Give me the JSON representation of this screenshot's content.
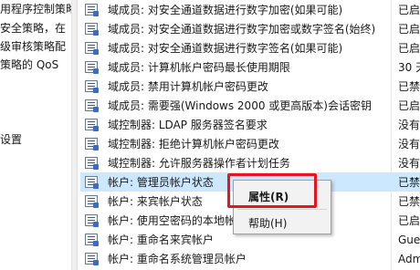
{
  "tree": {
    "items": [
      {
        "label": "用程序控制策略"
      },
      {
        "label": "安全策略，在"
      },
      {
        "label": "级审核策略配"
      },
      {
        "label": "策略的 QoS"
      },
      {
        "label": "设置"
      }
    ]
  },
  "policies": [
    {
      "name": "域成员: 对安全通道数据进行数字加密(如果可能)",
      "setting": "已启"
    },
    {
      "name": "域成员: 对安全通道数据进行数字加密或数字签名(始终)",
      "setting": "已启"
    },
    {
      "name": "域成员: 对安全通道数据进行数字签名(如果可能)",
      "setting": "已启"
    },
    {
      "name": "域成员: 计算机帐户密码最长使用期限",
      "setting": "30 天"
    },
    {
      "name": "域成员: 禁用计算机帐户密码更改",
      "setting": "已禁"
    },
    {
      "name": "域成员: 需要强(Windows 2000 或更高版本)会话密钥",
      "setting": "已启"
    },
    {
      "name": "域控制器: LDAP 服务器签名要求",
      "setting": "没有"
    },
    {
      "name": "域控制器: 拒绝计算机帐户密码更改",
      "setting": "没有"
    },
    {
      "name": "域控制器: 允许服务器操作者计划任务",
      "setting": "没有"
    },
    {
      "name": "帐户: 管理员帐户状态",
      "setting": "已禁"
    },
    {
      "name": "帐户: 来宾帐户状态",
      "setting": "已禁"
    },
    {
      "name": "帐户: 使用空密码的本地帐",
      "setting": "已启"
    },
    {
      "name": "帐户: 重命名来宾帐户",
      "setting": "Gues"
    },
    {
      "name": "帐户: 重命名系统管理员帐户",
      "setting": "Adm"
    }
  ],
  "context_menu": {
    "properties_label": "属性(R)",
    "help_label": "帮助(H)"
  },
  "colors": {
    "selection": "#cce8ff",
    "highlight_box": "#e8161c",
    "menu_bg": "#f2f2f2"
  }
}
